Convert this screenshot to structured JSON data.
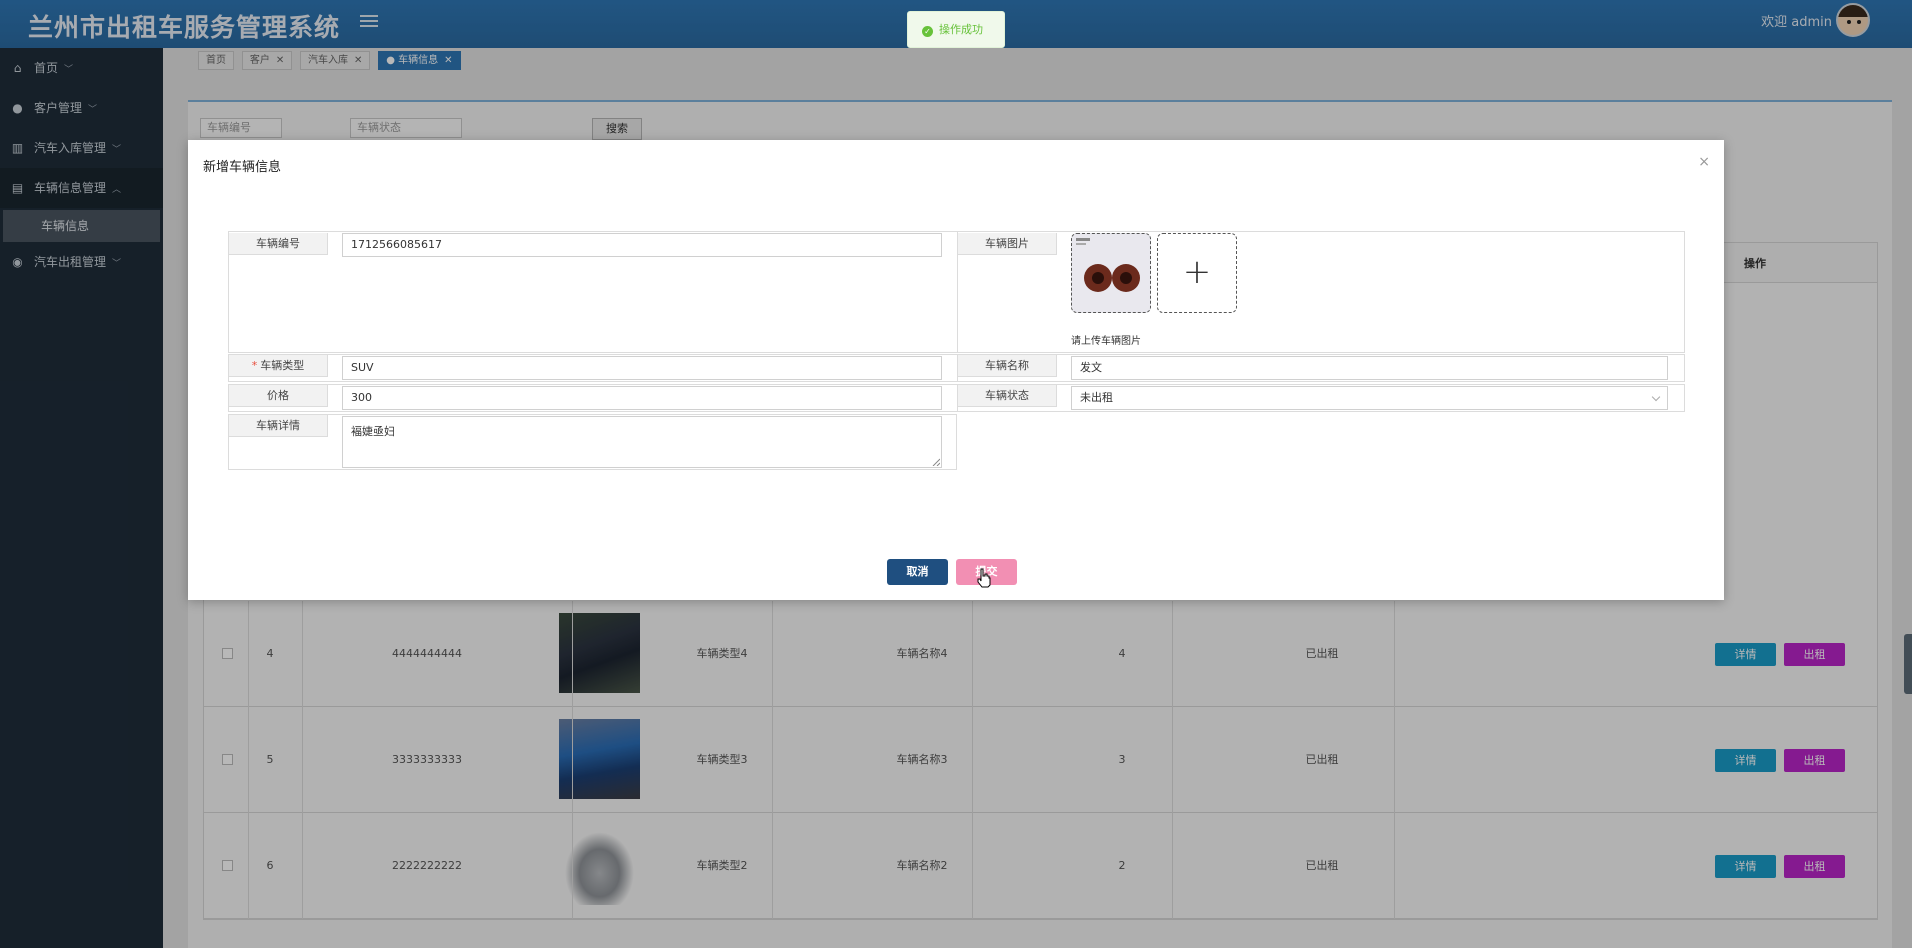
{
  "header": {
    "title": "兰州市出租车服务管理系统",
    "welcome": "欢迎 admin"
  },
  "toast": {
    "text": "操作成功",
    "icon": "check-circle-icon",
    "color": "#67c23a"
  },
  "sidebar": {
    "items": [
      {
        "label": "首页",
        "icon": "home-icon"
      },
      {
        "label": "客户管理",
        "icon": "user-icon"
      },
      {
        "label": "汽车入库管理",
        "icon": "columns-icon"
      },
      {
        "label": "车辆信息管理",
        "icon": "book-icon"
      },
      {
        "label": "汽车出租管理",
        "icon": "disc-icon"
      }
    ],
    "active_sub": "车辆信息"
  },
  "tabs": [
    {
      "label": "首页",
      "closable": false
    },
    {
      "label": "客户",
      "closable": true
    },
    {
      "label": "汽车入库",
      "closable": true
    },
    {
      "label": "● 车辆信息",
      "closable": true,
      "active": true
    }
  ],
  "search": {
    "number_placeholder": "车辆编号",
    "status_placeholder": "车辆状态",
    "button": "搜索"
  },
  "table": {
    "op_header": "操作",
    "rows": [
      {
        "index": "4",
        "number": "4444444444",
        "type": "车辆类型4",
        "name": "车辆名称4",
        "price": "4",
        "status": "已出租"
      },
      {
        "index": "5",
        "number": "3333333333",
        "type": "车辆类型3",
        "name": "车辆名称3",
        "price": "3",
        "status": "已出租"
      },
      {
        "index": "6",
        "number": "2222222222",
        "type": "车辆类型2",
        "name": "车辆名称2",
        "price": "2",
        "status": "已出租"
      }
    ],
    "detail_label": "详情",
    "rent_label": "出租"
  },
  "dialog": {
    "title": "新增车辆信息",
    "close": "×",
    "fields": {
      "number": {
        "label": "车辆编号",
        "value": "1712566085617"
      },
      "image": {
        "label": "车辆图片",
        "tip": "请上传车辆图片"
      },
      "type": {
        "label": "车辆类型",
        "value": "SUV",
        "required_mark": "*"
      },
      "name": {
        "label": "车辆名称",
        "value": "发文"
      },
      "price": {
        "label": "价格",
        "value": "300"
      },
      "status": {
        "label": "车辆状态",
        "value": "未出租"
      },
      "detail": {
        "label": "车辆详情",
        "value": "褔婕亟妇"
      }
    },
    "cancel": "取消",
    "submit": "提交"
  },
  "colors": {
    "header": "#2f77b5",
    "sidebar": "#1f2d3a",
    "cancel": "#1f4f80",
    "submit": "#f28fb3",
    "detail_btn": "#1a9bc8",
    "rent_btn": "#b924c8"
  }
}
